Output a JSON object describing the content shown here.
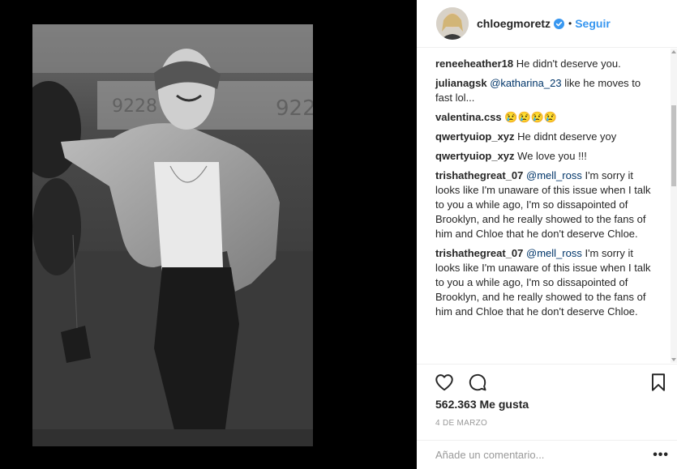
{
  "post": {
    "username": "chloegmoretz",
    "follow_label": "Seguir",
    "separator": "•",
    "photo_alt": "Black and white photo of a smiling man in a light jacket and flat cap at night"
  },
  "comments": [
    {
      "user": "reneeheather18",
      "text": "He didn't deserve you.",
      "mention": ""
    },
    {
      "user": "julianagsk",
      "mention": "@katharina_23",
      "text": " like he moves to fast lol..."
    },
    {
      "user": "valentina.css",
      "mention": "",
      "text": "😢😢😢😢"
    },
    {
      "user": "qwertyuiop_xyz",
      "mention": "",
      "text": "He didnt deserve yoy"
    },
    {
      "user": "qwertyuiop_xyz",
      "mention": "",
      "text": "We love you !!!"
    },
    {
      "user": "trishathegreat_07",
      "mention": "@mell_ross",
      "text": " I'm sorry it looks like I'm unaware of this issue when I talk to you a while ago, I'm so dissapointed of Brooklyn, and he really showed to the fans of him and Chloe that he don't deserve Chloe."
    },
    {
      "user": "trishathegreat_07",
      "mention": "@mell_ross",
      "text": " I'm sorry it looks like I'm unaware of this issue when I talk to you a while ago, I'm so dissapointed of Brooklyn, and he really showed to the fans of him and Chloe that he don't deserve Chloe."
    }
  ],
  "likes": "562.363 Me gusta",
  "date": "4 DE MARZO",
  "comment_placeholder": "Añade un comentario...",
  "more_label": "•••",
  "icons": {
    "like": "heart-icon",
    "comment": "comment-icon",
    "save": "bookmark-icon",
    "verified": "verified-badge-icon"
  },
  "colors": {
    "accent": "#3897f0",
    "verified": "#3897f0",
    "text": "#262626",
    "muted": "#999999"
  }
}
